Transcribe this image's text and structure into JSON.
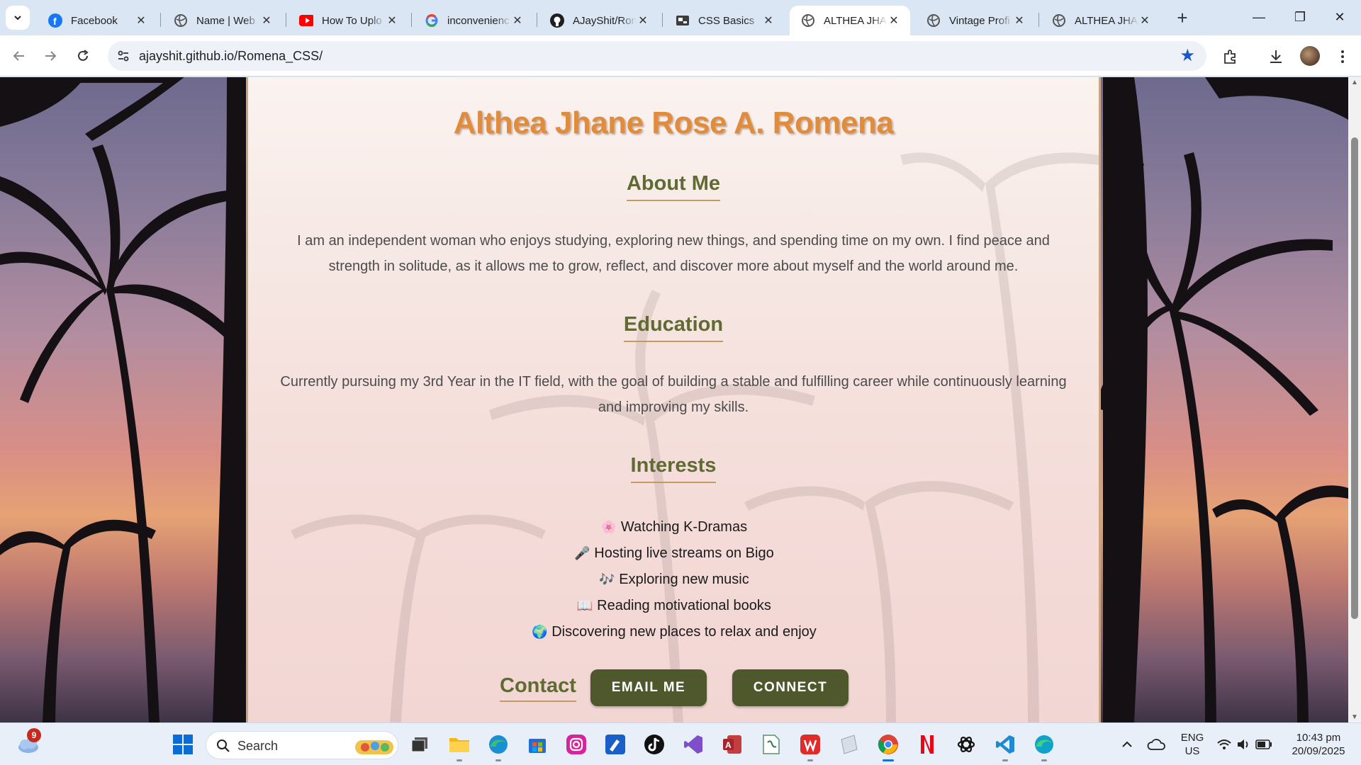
{
  "browser": {
    "tabs": [
      {
        "title": "Facebook",
        "icon": "facebook-icon",
        "active": false
      },
      {
        "title": "Name | Web",
        "icon": "globe-icon",
        "active": false
      },
      {
        "title": "How To Uplo",
        "icon": "youtube-icon",
        "active": false
      },
      {
        "title": "inconvenienc",
        "icon": "google-icon",
        "active": false
      },
      {
        "title": "AJayShit/Ron",
        "icon": "github-icon",
        "active": false
      },
      {
        "title": "CSS Basics",
        "icon": "slides-icon",
        "active": false
      },
      {
        "title": "ALTHEA JHAN",
        "icon": "globe-icon",
        "active": true
      },
      {
        "title": "Vintage Profi",
        "icon": "globe-icon",
        "active": false
      },
      {
        "title": "ALTHEA JHAN",
        "icon": "globe-icon",
        "active": false
      }
    ],
    "url": "ajayshit.github.io/Romena_CSS/",
    "colors": {
      "accent": "#1a57c9",
      "tabstrip": "#dbe6f4"
    }
  },
  "page": {
    "name": "Althea Jhane Rose A. Romena",
    "about": {
      "heading": "About Me",
      "text": "I am an independent woman who enjoys studying, exploring new things, and spending time on my own. I find peace and strength in solitude, as it allows me to grow, reflect, and discover more about myself and the world around me."
    },
    "education": {
      "heading": "Education",
      "text": "Currently pursuing my 3rd Year in the IT field, with the goal of building a stable and fulfilling career while continuously learning and improving my skills."
    },
    "interests": {
      "heading": "Interests",
      "items": [
        {
          "emoji": "🌸",
          "label": "Watching K-Dramas"
        },
        {
          "emoji": "🎤",
          "label": "Hosting live streams on Bigo"
        },
        {
          "emoji": "🎶",
          "label": "Exploring new music"
        },
        {
          "emoji": "📖",
          "label": "Reading motivational books"
        },
        {
          "emoji": "🌍",
          "label": "Discovering new places to relax and enjoy"
        }
      ]
    },
    "contact": {
      "heading": "Contact",
      "email_label": "EMAIL ME",
      "connect_label": "CONNECT"
    },
    "colors": {
      "name": "#e08c3c",
      "heading": "#5f6b33",
      "button": "#4f582c",
      "underline": "#c49a64"
    }
  },
  "taskbar": {
    "weather_badge": "9",
    "search_placeholder": "Search",
    "language": "ENG",
    "region": "US",
    "time": "10:43 pm",
    "date": "20/09/2025"
  }
}
